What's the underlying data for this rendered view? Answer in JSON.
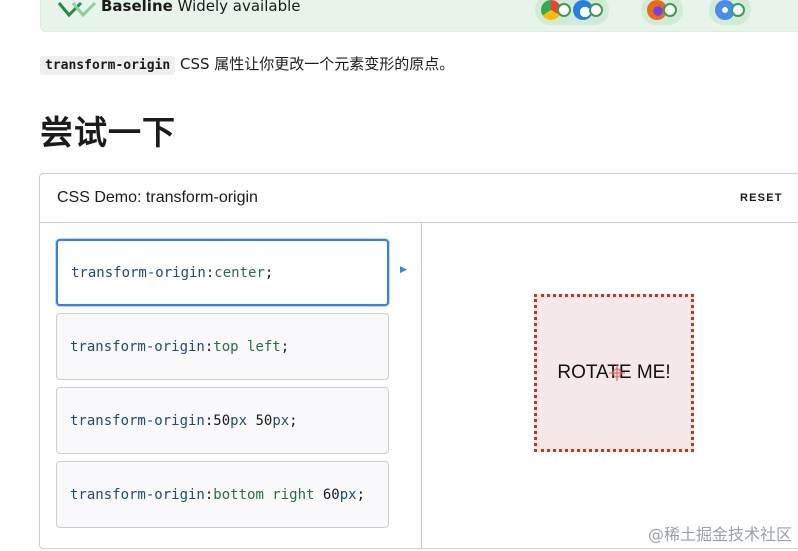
{
  "baseline": {
    "label_bold": "Baseline",
    "label_rest": " Widely available"
  },
  "intro": {
    "code": "transform-origin",
    "text": " CSS 属性让你更改一个元素变形的原点。"
  },
  "section_heading": "尝试一下",
  "demo": {
    "title": "CSS Demo: transform-origin",
    "reset_label": "RESET",
    "choices": [
      {
        "prop": "transform-origin",
        "colon": ": ",
        "parts": [
          "center",
          ";"
        ]
      },
      {
        "prop": "transform-origin",
        "colon": ": ",
        "parts": [
          "top left",
          ";"
        ]
      },
      {
        "prop": "transform-origin",
        "colon": ": ",
        "parts": [
          "50",
          "px",
          " ",
          "50",
          "px",
          ";"
        ]
      },
      {
        "prop": "transform-origin",
        "colon": ": ",
        "parts": [
          "bottom right ",
          "60",
          "px",
          ";"
        ]
      }
    ],
    "selected_index": 0,
    "output_text": "ROTATE ME!"
  },
  "watermark": "@稀土掘金技术社区",
  "colors": {
    "accent": "#3a81d9",
    "dotted_border": "#c7361b",
    "box_bg": "#f4e8e8",
    "baseline_bg": "#e7f4e9"
  }
}
